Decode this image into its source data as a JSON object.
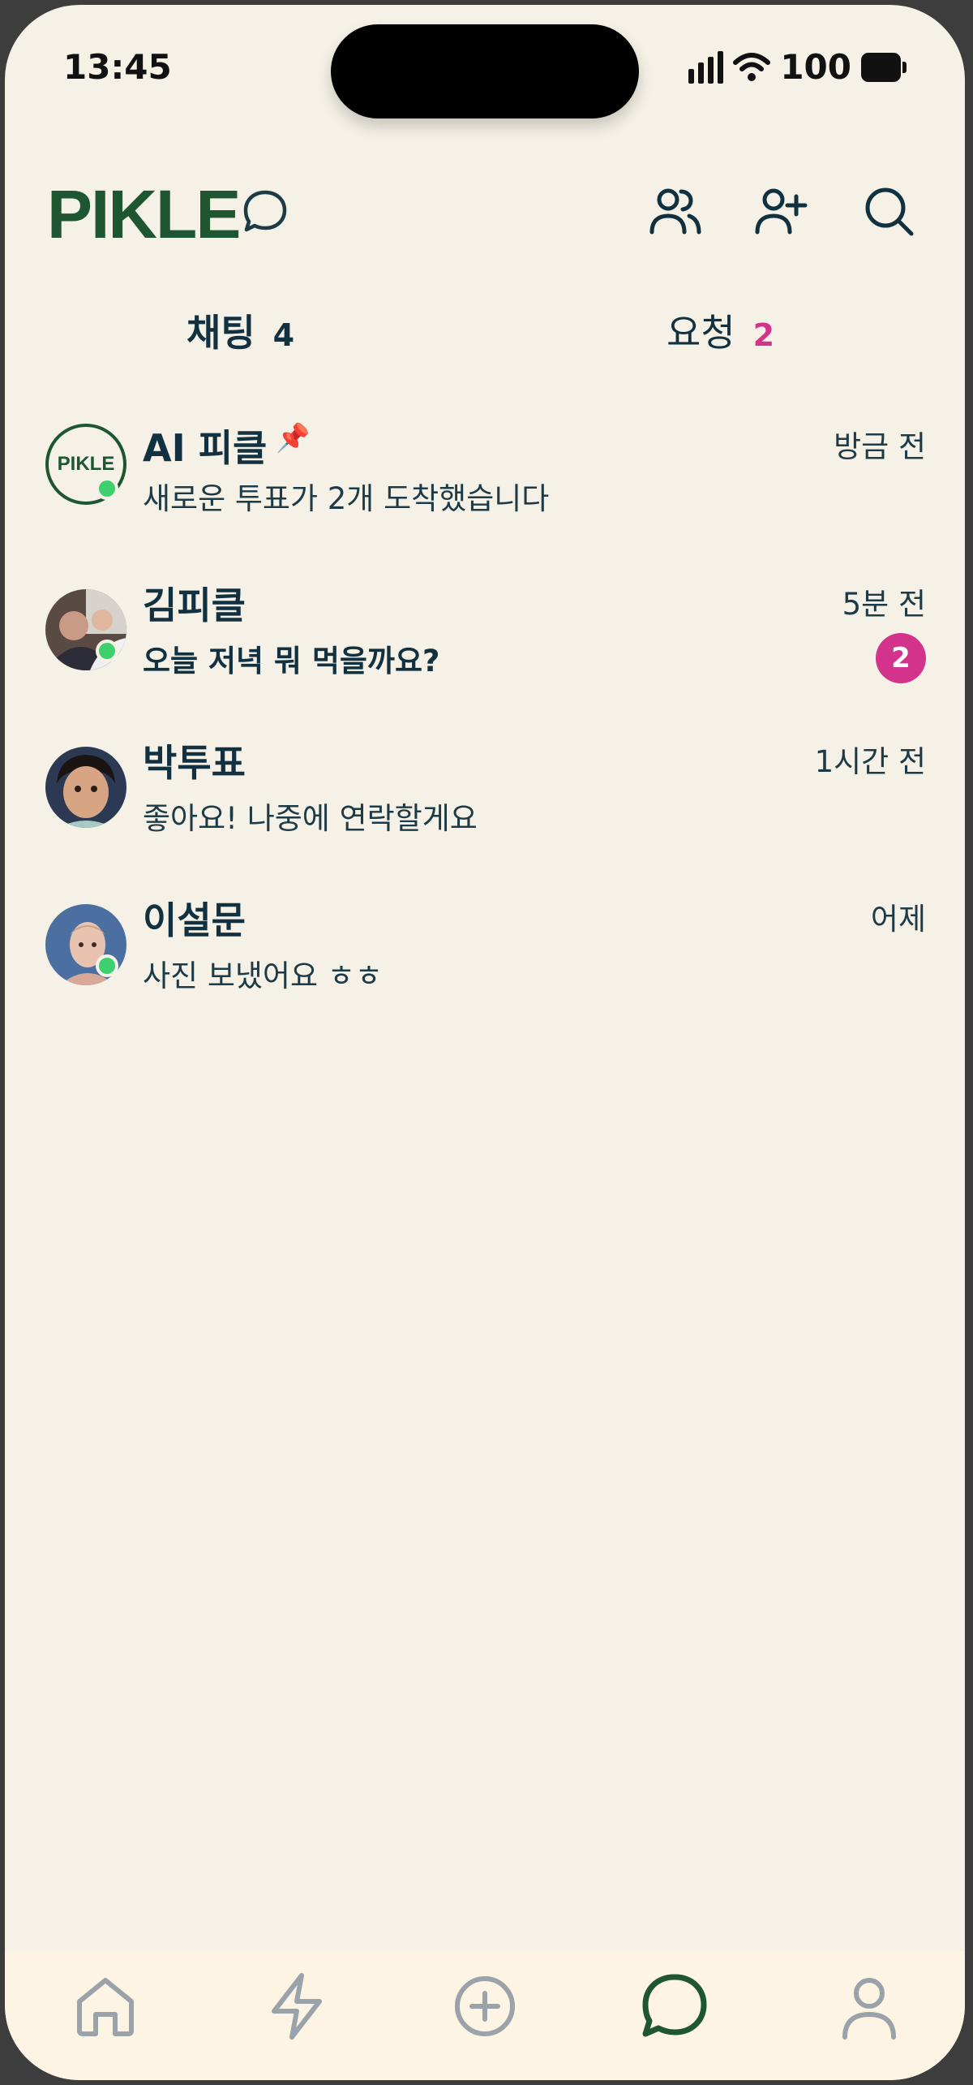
{
  "status_bar": {
    "time": "13:45",
    "battery": "100"
  },
  "header": {
    "logo": "PIKLE",
    "icons": [
      "chat-bubble-icon",
      "friends-icon",
      "add-user-icon",
      "search-icon"
    ]
  },
  "tabs": [
    {
      "label": "채팅",
      "count": "4",
      "active": true
    },
    {
      "label": "요청",
      "count": "2",
      "active": false
    }
  ],
  "chats": [
    {
      "name": "AI 피클",
      "pinned": true,
      "pin_icon": "pin-icon",
      "avatar_text": "PIKLE",
      "message": "새로운 투표가 2개 도착했습니다",
      "time": "방금 전",
      "online": true,
      "unread": null
    },
    {
      "name": "김피클",
      "pinned": false,
      "message": "오늘 저녁 뭐 먹을까요?",
      "time": "5분 전",
      "online": true,
      "unread": "2"
    },
    {
      "name": "박투표",
      "pinned": false,
      "message": "좋아요! 나중에 연락할게요",
      "time": "1시간 전",
      "online": false,
      "unread": null
    },
    {
      "name": "이설문",
      "pinned": false,
      "message": "사진 보냈어요 ㅎㅎ",
      "time": "어제",
      "online": true,
      "unread": null
    }
  ],
  "bottom_nav": [
    {
      "icon": "home-icon",
      "active": false
    },
    {
      "icon": "lightning-icon",
      "active": false
    },
    {
      "icon": "plus-circle-icon",
      "active": false
    },
    {
      "icon": "chat-icon",
      "active": true
    },
    {
      "icon": "profile-icon",
      "active": false
    }
  ],
  "colors": {
    "background": "#f5f1e7",
    "brand_green": "#1e5631",
    "text_dark": "#123140",
    "accent_pink": "#d3338a",
    "online_green": "#3ecf6e",
    "nav_inactive": "#9aa3aa",
    "nav_background": "#fdf4e4"
  }
}
